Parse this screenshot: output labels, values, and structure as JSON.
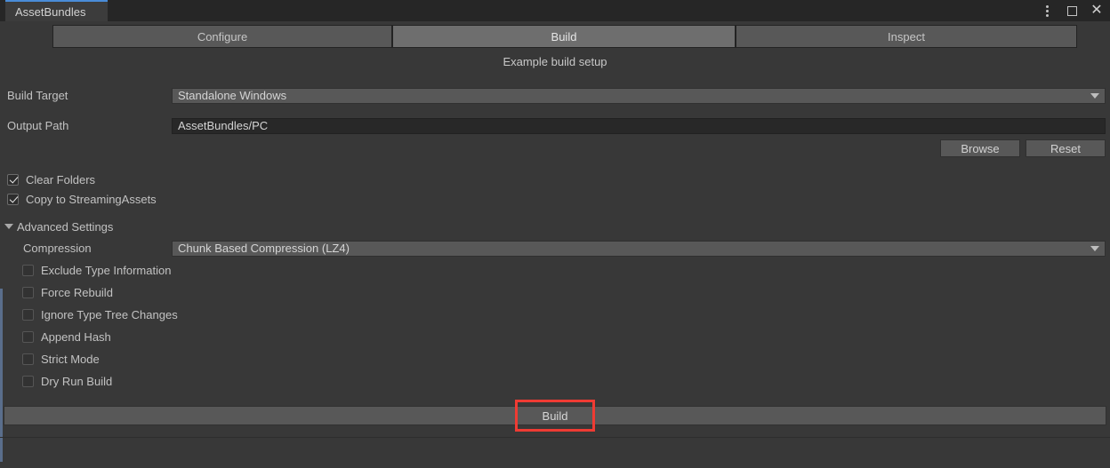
{
  "window": {
    "tab_title": "AssetBundles",
    "controls": {
      "menu": "⋮",
      "maximize": "",
      "close": "✕"
    },
    "accent_color": "#4a8cd8"
  },
  "toolbar": {
    "tabs": [
      {
        "label": "Configure",
        "selected": false
      },
      {
        "label": "Build",
        "selected": true
      },
      {
        "label": "Inspect",
        "selected": false
      }
    ]
  },
  "subtitle": "Example build setup",
  "fields": {
    "build_target": {
      "label": "Build Target",
      "value": "Standalone Windows",
      "type": "dropdown"
    },
    "output_path": {
      "label": "Output Path",
      "value": "AssetBundles/PC",
      "placeholder": "",
      "type": "text"
    }
  },
  "buttons": {
    "browse": "Browse",
    "reset": "Reset",
    "build": "Build"
  },
  "toggles": [
    {
      "label": "Clear Folders",
      "checked": true
    },
    {
      "label": "Copy to StreamingAssets",
      "checked": true
    }
  ],
  "advanced": {
    "label": "Advanced Settings",
    "expanded": true,
    "compression": {
      "label": "Compression",
      "value": "Chunk Based Compression (LZ4)",
      "type": "dropdown"
    },
    "options": [
      {
        "label": "Exclude Type Information",
        "checked": false
      },
      {
        "label": "Force Rebuild",
        "checked": false
      },
      {
        "label": "Ignore Type Tree Changes",
        "checked": false
      },
      {
        "label": "Append Hash",
        "checked": false
      },
      {
        "label": "Strict Mode",
        "checked": false
      },
      {
        "label": "Dry Run Build",
        "checked": false
      }
    ]
  },
  "annotation": {
    "color": "#ef3b33",
    "target": "Build"
  }
}
